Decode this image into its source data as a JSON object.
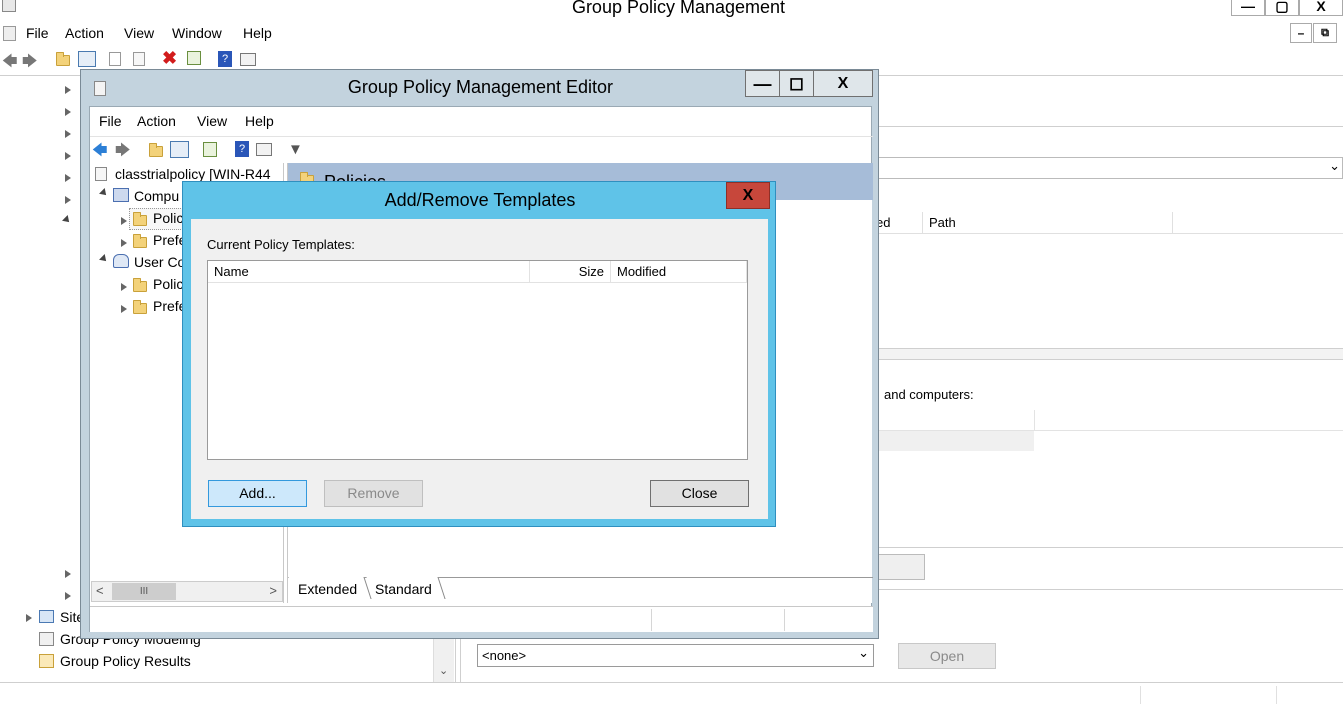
{
  "main_window": {
    "title": "Group Policy Management",
    "menu": [
      "File",
      "Action",
      "View",
      "Window",
      "Help"
    ],
    "tree_bottom": [
      "Sites",
      "Group Policy Modeling",
      "Group Policy Results"
    ],
    "right_fragments": {
      "path_header": "Path",
      "ed_header": "ed",
      "users_computers": "and computers:",
      "wmi_select": "<none>",
      "open_button": "Open"
    }
  },
  "editor": {
    "title": "Group Policy Management Editor",
    "menu": [
      "File",
      "Action",
      "View",
      "Help"
    ],
    "tree": {
      "root": "classtrialpolicy [WIN-R44",
      "computer": "Compu",
      "policies1": "Polic",
      "prefs1": "Prefe",
      "user": "User Co",
      "policies2": "Polic",
      "prefs2": "Prefe"
    },
    "right_header": "Policies",
    "tabs": [
      "Extended",
      "Standard"
    ],
    "hscroll_thumb": "III"
  },
  "dialog": {
    "title": "Add/Remove Templates",
    "current_label": "Current Policy Templates:",
    "columns": [
      "Name",
      "Size",
      "Modified"
    ],
    "buttons": {
      "add": "Add...",
      "remove": "Remove",
      "close": "Close"
    },
    "close_x": "X"
  },
  "colors": {
    "title_bar": "#c3d3de",
    "dialog_frame": "#5fc3e8",
    "close_red": "#c7473b",
    "selection": "#cde8fb",
    "panel_header": "#a6bcd8"
  }
}
